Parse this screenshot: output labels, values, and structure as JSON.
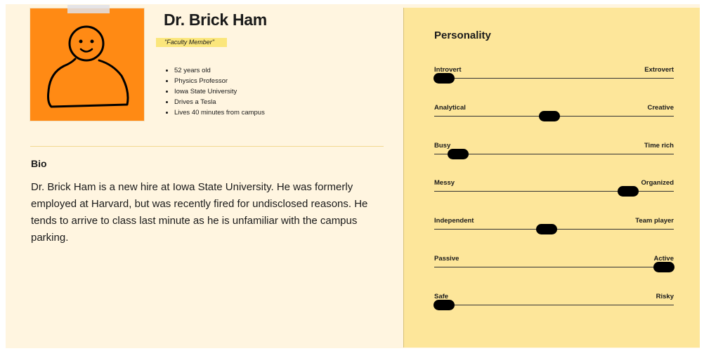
{
  "persona": {
    "name": "Dr. Brick Ham",
    "role": "\"Faculty Member\"",
    "facts": [
      "52 years old",
      "Physics Professor",
      "Iowa State University",
      "Drives a Tesla",
      "Lives 40 minutes from campus"
    ]
  },
  "bio": {
    "heading": "Bio",
    "text": "Dr. Brick Ham is a new hire at Iowa State University. He was formerly employed at Harvard, but was recently fired for undisclosed reasons. He tends to arrive to class last minute as he is unfamiliar with the campus parking."
  },
  "personality": {
    "title": "Personality",
    "traits": [
      {
        "left": "Introvert",
        "right": "Extrovert",
        "value": 0.04
      },
      {
        "left": "Analytical",
        "right": "Creative",
        "value": 0.48
      },
      {
        "left": "Busy",
        "right": "Time rich",
        "value": 0.1
      },
      {
        "left": "Messy",
        "right": "Organized",
        "value": 0.81
      },
      {
        "left": "Independent",
        "right": "Team player",
        "value": 0.47
      },
      {
        "left": "Passive",
        "right": "Active",
        "value": 0.96
      },
      {
        "left": "Safe",
        "right": "Risky",
        "value": 0.04
      }
    ]
  },
  "colors": {
    "avatar_bg": "#ff8a14",
    "panel_bg": "#fde69a",
    "page_bg": "#fff5e0",
    "tag_highlight": "#fbe67c"
  }
}
